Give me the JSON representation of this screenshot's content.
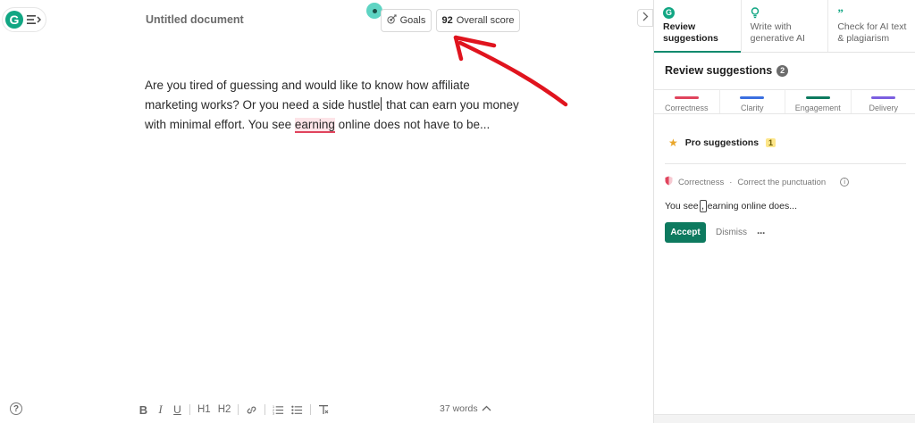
{
  "editor": {
    "title": "Untitled document",
    "goals_label": "Goals",
    "score_value": "92",
    "score_label": "Overall score",
    "body": {
      "part1": "Are you tired of guessing and would like to know how affiliate marketing works? Or you need a side hustle",
      "part2": " that can earn you money with minimal effort. You see ",
      "highlight": "earning",
      "part3": " online does not have to be..."
    },
    "word_count": "37 words",
    "toolbar": {
      "bold": "B",
      "italic": "I",
      "underline": "U",
      "h1": "H1",
      "h2": "H2"
    },
    "help_label": "?"
  },
  "panel": {
    "tabs": [
      {
        "label": "Review suggestions",
        "icon": "grammarly-g-icon"
      },
      {
        "label": "Write with generative AI",
        "icon": "bulb-icon"
      },
      {
        "label": "Check for AI text & plagiarism",
        "icon": "quote-icon"
      }
    ],
    "section_title": "Review suggestions",
    "section_count": "2",
    "categories": [
      {
        "label": "Correctness",
        "color": "#e0445d"
      },
      {
        "label": "Clarity",
        "color": "#3a6fe0"
      },
      {
        "label": "Engagement",
        "color": "#0d7a5f"
      },
      {
        "label": "Delivery",
        "color": "#7b5fe0"
      }
    ],
    "pro": {
      "label": "Pro suggestions",
      "count": "1"
    },
    "card": {
      "category": "Correctness",
      "sep": "·",
      "description": "Correct the punctuation",
      "text_before": "You see",
      "comma": ",",
      "text_after": " earning online does...",
      "accept": "Accept",
      "dismiss": "Dismiss",
      "more": "···"
    }
  },
  "colors": {
    "accent": "#0d7a5f",
    "brand": "#11a683",
    "annotation_arrow": "#e0141e"
  }
}
